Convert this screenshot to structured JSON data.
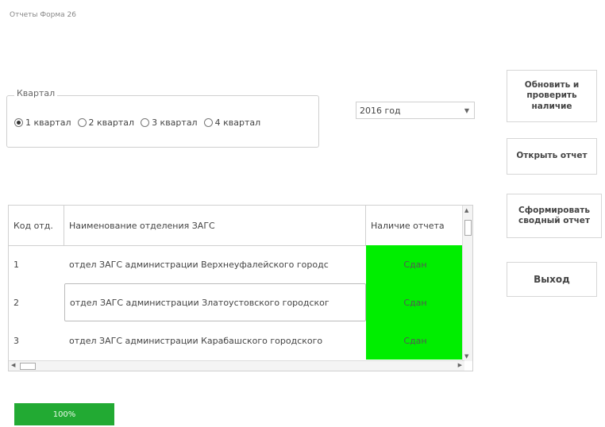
{
  "window": {
    "title": "Отчеты Форма 26"
  },
  "quarter_group": {
    "legend": "Квартал",
    "options": [
      "1 квартал",
      "2 квартал",
      "3 квартал",
      "4 квартал"
    ],
    "selected_index": 0
  },
  "year_select": {
    "value": "2016 год"
  },
  "buttons": {
    "refresh": "Обновить и проверить наличие",
    "open": "Открыть отчет",
    "summary": "Сформировать сводный отчет",
    "exit": "Выход"
  },
  "grid": {
    "columns": [
      "Код отд.",
      "Наименование отделения ЗАГС",
      "Наличие отчета"
    ],
    "rows": [
      {
        "code": "1",
        "name": "отдел ЗАГС администрации Верхнеуфалейского городс",
        "status": "Сдан"
      },
      {
        "code": "2",
        "name": "отдел ЗАГС администрации Златоустовского городског",
        "status": "Сдан"
      },
      {
        "code": "3",
        "name": "отдел ЗАГС администрации Карабашского городского",
        "status": "Сдан"
      }
    ],
    "selected_row": 1,
    "status_color": "#00ee00"
  },
  "progress": {
    "label": "100%",
    "value": 1.0,
    "color": "#22aa33"
  }
}
